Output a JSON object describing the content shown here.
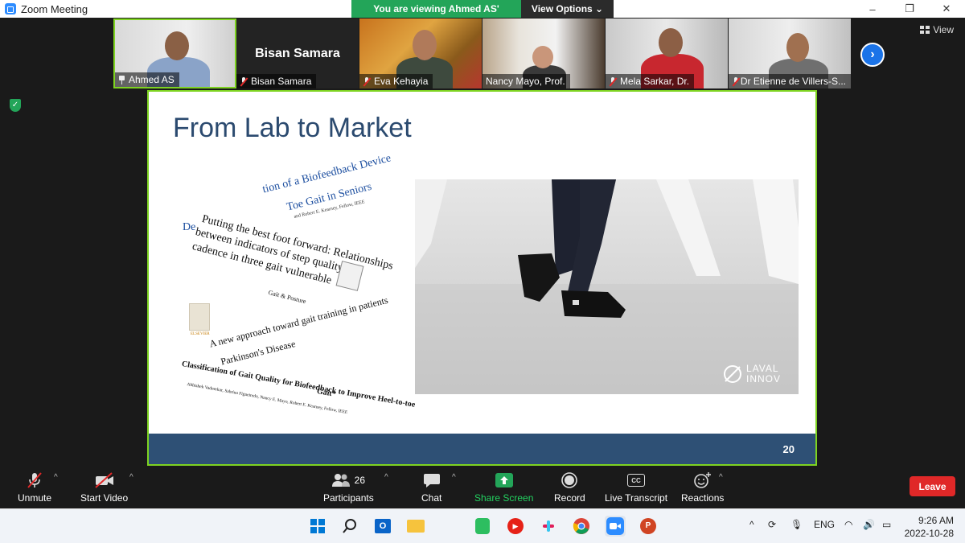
{
  "window": {
    "title": "Zoom Meeting",
    "controls": [
      "–",
      "❐",
      "✕"
    ]
  },
  "banner": {
    "viewing_text": "You are viewing Ahmed AS' screen",
    "view_options": "View Options ⌄"
  },
  "view_button": "View",
  "participants": [
    {
      "name": "Ahmed AS",
      "muted": false,
      "pinned": true
    },
    {
      "name": "Bisan Samara",
      "muted": true,
      "card_name": "Bisan Samara"
    },
    {
      "name": "Eva Kehayia",
      "muted": true
    },
    {
      "name": "Nancy Mayo, Prof.",
      "muted": false
    },
    {
      "name": "Mela Sarkar, Dr.",
      "muted": true
    },
    {
      "name": "Dr Etienne de Villers-S...",
      "muted": true
    }
  ],
  "slide": {
    "title": "From Lab to Market",
    "page_number": "20",
    "logo_text_1": "LAVAL",
    "logo_text_2": "INNOV",
    "paper_lines": [
      "tion of a Biofeedback Device",
      "Toe Gait in Seniors",
      "and Robert E. Kearney, Fellow, IEEE",
      "De",
      "Putting the best foot forward: Relationships",
      "between indicators of step quality and",
      "cadence in three gait vulnerable",
      "Gait & Posture",
      "A new approach toward gait training in patients",
      "Parkinson's Disease",
      "Classification of Gait Quality for Biofeedback to Improve Heel-to-toe",
      "Gait*",
      "Abhishek Vadnerkar, Sabrina Figueiredo, Nancy E. Mayo, Robert E. Kearney, Fellow, IEEE",
      "ELSEVIER"
    ]
  },
  "toolbar": {
    "unmute": "Unmute",
    "start_video": "Start Video",
    "participants": "Participants",
    "participants_count": "26",
    "chat": "Chat",
    "share_screen": "Share Screen",
    "record": "Record",
    "live_transcript": "Live Transcript",
    "reactions": "Reactions",
    "leave": "Leave",
    "cc_label": "CC"
  },
  "taskbar": {
    "language": "ENG",
    "time": "9:26 AM",
    "date": "2022-10-28"
  },
  "colors": {
    "zoom_blue": "#2D8CFF",
    "banner_green": "#23a559",
    "active_border": "#7ed321",
    "leave_red": "#e02828",
    "slide_title": "#2b4a6f",
    "slide_footer": "#2e5075"
  }
}
